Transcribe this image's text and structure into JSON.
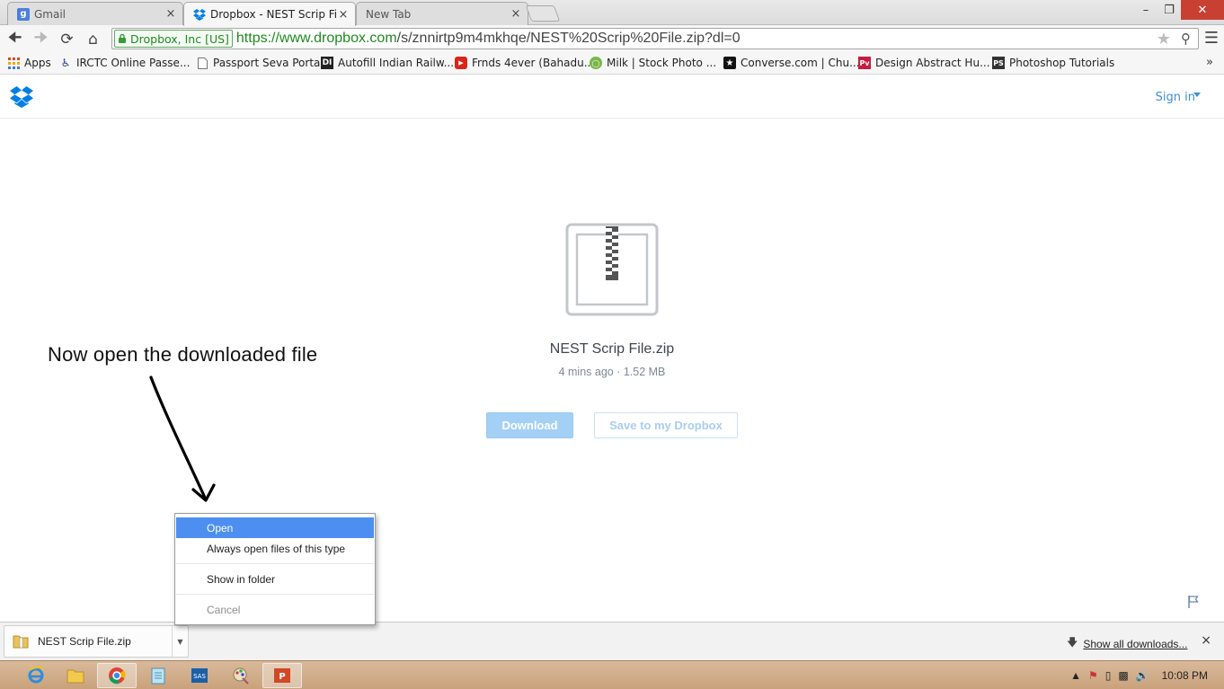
{
  "browser": {
    "tabs": [
      {
        "title": "Gmail",
        "active": false
      },
      {
        "title": "Dropbox - NEST Scrip File",
        "active": true
      },
      {
        "title": "New Tab",
        "active": false
      }
    ],
    "close_glyph": "×",
    "ev_label": "Dropbox, Inc [US]",
    "url_host": "https://www.dropbox.com",
    "url_path": "/s/znnirtp9m4mkhqe/NEST%20Scrip%20File.zip?dl=0",
    "bookmarks": [
      {
        "label": "Apps",
        "icon": "apps-grid-icon"
      },
      {
        "label": "IRCTC Online Passe...",
        "icon": "irctc-icon"
      },
      {
        "label": "Passport Seva Portal",
        "icon": "page-icon"
      },
      {
        "label": "Autofill Indian Railw...",
        "icon": "di-icon"
      },
      {
        "label": "Frnds 4ever (Bahadu...",
        "icon": "youtube-icon"
      },
      {
        "label": "Milk | Stock Photo ...",
        "icon": "milk-icon"
      },
      {
        "label": "Converse.com | Chu...",
        "icon": "converse-star-icon"
      },
      {
        "label": "Design Abstract Hu...",
        "icon": "pv-icon"
      },
      {
        "label": "Photoshop Tutorials",
        "icon": "ps-icon"
      }
    ],
    "bookmarks_more": "»"
  },
  "dropbox": {
    "signin_label": "Sign in",
    "file_name": "NEST Scrip File.zip",
    "file_meta": "4 mins ago · 1.52 MB",
    "download_label": "Download",
    "save_label": "Save to my Dropbox",
    "brand_color": "#007ee5"
  },
  "annotation": {
    "text": "Now open the downloaded file"
  },
  "context_menu": {
    "items": [
      {
        "label": "Open",
        "state": "selected"
      },
      {
        "label": "Always open files of this type",
        "state": "normal"
      },
      {
        "label": "Show in folder",
        "state": "normal"
      },
      {
        "label": "Cancel",
        "state": "disabled"
      }
    ]
  },
  "download_shelf": {
    "item_name": "NEST Scrip File.zip",
    "show_all_label": "Show all downloads...",
    "close_glyph": "×"
  },
  "taskbar": {
    "clock": "10:08 PM"
  }
}
